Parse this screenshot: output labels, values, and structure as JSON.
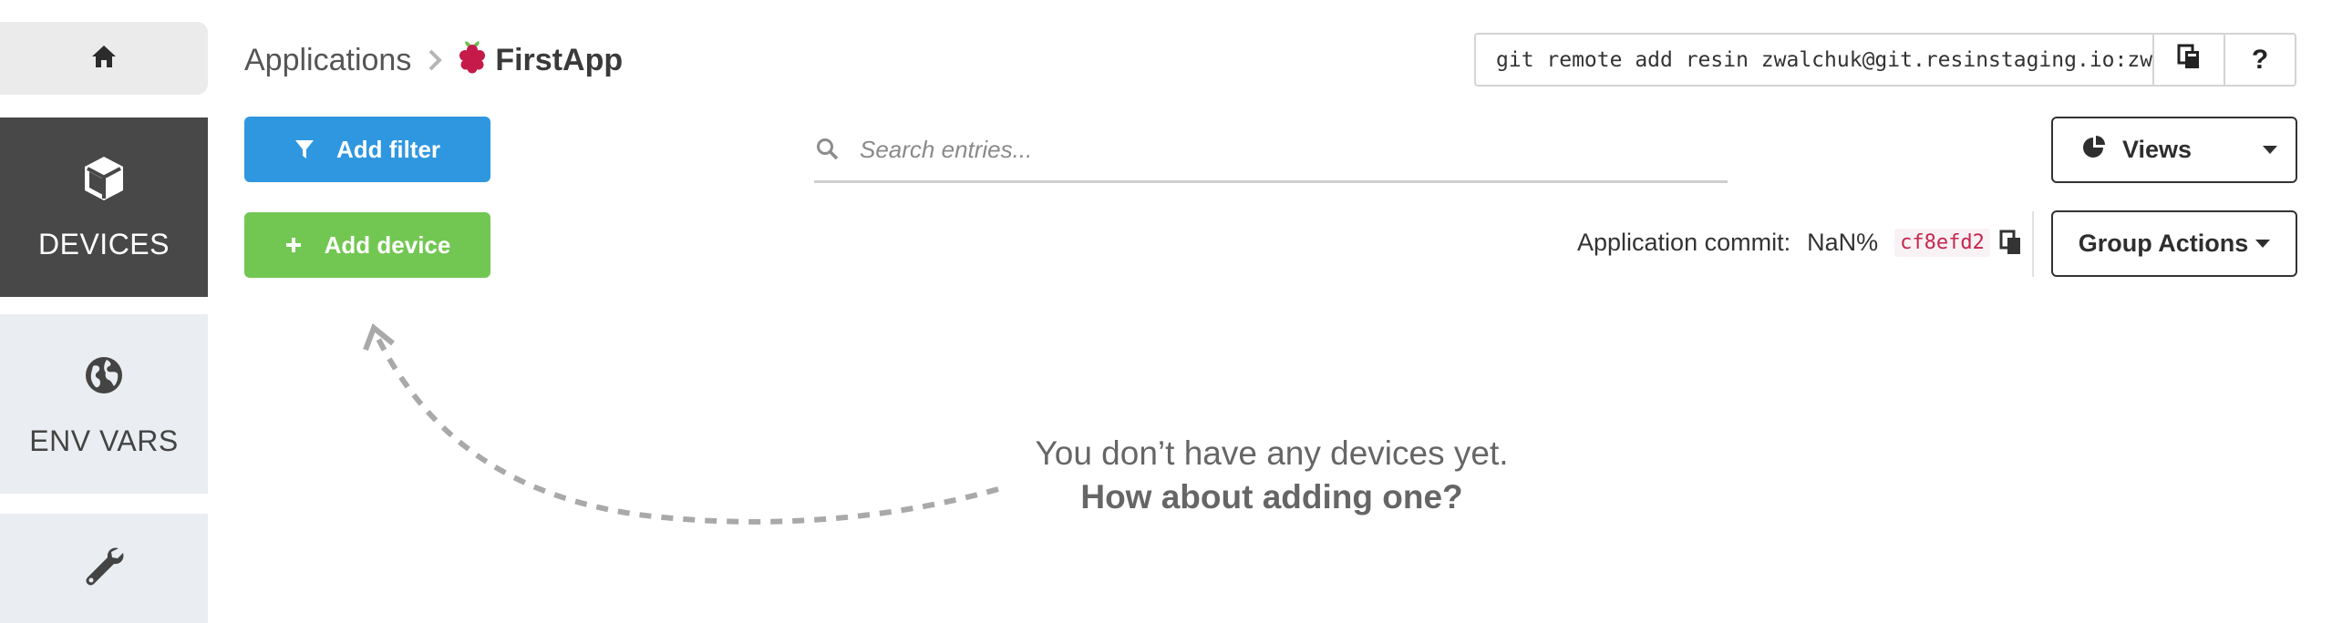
{
  "sidebar": {
    "home_icon": "home-icon",
    "items": [
      {
        "label": "DEVICES",
        "icon": "cube-icon",
        "active": true
      },
      {
        "label": "ENV VARS",
        "icon": "globe-icon",
        "active": false
      },
      {
        "label": "",
        "icon": "wrench-icon",
        "active": false
      }
    ]
  },
  "breadcrumb": {
    "root": "Applications",
    "app_name": "FirstApp",
    "app_icon": "raspberry-pi-icon"
  },
  "git_remote": {
    "command": "git remote add resin zwalchuk@git.resinstaging.io:zwalchuk/firstapp.git",
    "copy_icon": "copy-icon",
    "help_label": "?"
  },
  "toolbar": {
    "add_filter_label": "Add filter",
    "add_device_label": "Add device",
    "search_placeholder": "Search entries...",
    "views_label": "Views",
    "group_actions_label": "Group Actions"
  },
  "commit": {
    "label": "Application commit:",
    "value": "NaN%",
    "hash": "cf8efd2"
  },
  "empty_state": {
    "line1": "You don’t have any devices yet.",
    "line2": "How about adding one?"
  },
  "colors": {
    "primary": "#2f97e0",
    "success": "#72c752",
    "sidebar_active": "#484848",
    "sidebar_inactive": "#eaedf1",
    "commit_hash": "#c7254e"
  }
}
